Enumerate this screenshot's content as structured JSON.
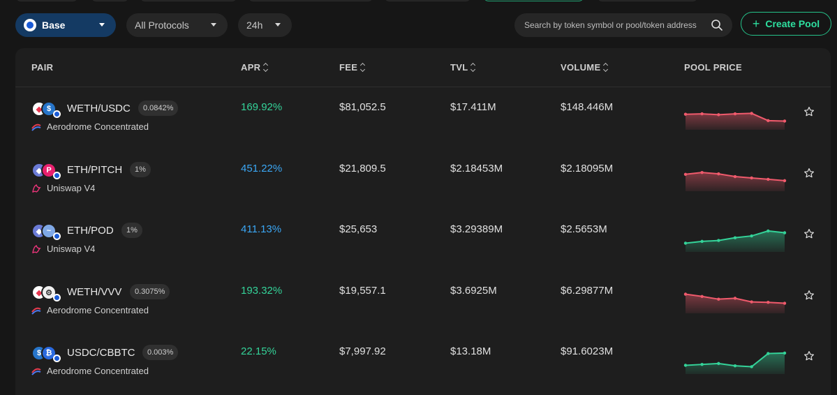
{
  "toolbar": {
    "chain_label": "Base",
    "protocol_filter": "All Protocols",
    "period": "24h",
    "search_placeholder": "Search by token symbol or pool/token address",
    "create_label": "Create Pool"
  },
  "columns": {
    "pair": "PAIR",
    "apr": "APR",
    "fee": "FEE",
    "tvl": "TVL",
    "volume": "VOLUME",
    "pool_price": "POOL PRICE"
  },
  "colors": {
    "positive": "#34d399",
    "negative": "#f05a6c",
    "apr_blue": "#3ba7f5",
    "accent": "#25c28a"
  },
  "rows": [
    {
      "pair": "WETH/USDC",
      "fee_tier": "0.0842%",
      "protocol": "Aerodrome Concentrated",
      "protocol_icon": "aerodrome-icon",
      "apr": "169.92%",
      "apr_color": "green",
      "fee": "$81,052.5",
      "tvl": "$17.411M",
      "volume": "$148.446M",
      "trend": "down",
      "price_series": [
        3,
        3.1,
        2.9,
        3.1,
        3.2,
        1.6,
        1.5
      ],
      "token_icons": [
        "weth-icon",
        "usdc-icon"
      ]
    },
    {
      "pair": "ETH/PITCH",
      "fee_tier": "1%",
      "protocol": "Uniswap V4",
      "protocol_icon": "uniswap-icon",
      "apr": "451.22%",
      "apr_color": "blue",
      "fee": "$21,809.5",
      "tvl": "$2.18453M",
      "volume": "$2.18095M",
      "trend": "down",
      "price_series": [
        3.3,
        3.7,
        3.4,
        2.8,
        2.5,
        2.2,
        1.9
      ],
      "token_icons": [
        "eth-icon",
        "pitch-icon"
      ]
    },
    {
      "pair": "ETH/POD",
      "fee_tier": "1%",
      "protocol": "Uniswap V4",
      "protocol_icon": "uniswap-icon",
      "apr": "411.13%",
      "apr_color": "blue",
      "fee": "$25,653",
      "tvl": "$3.29389M",
      "volume": "$2.5653M",
      "trend": "up",
      "price_series": [
        1.5,
        1.9,
        2.1,
        2.7,
        3.1,
        4.2,
        3.8
      ],
      "token_icons": [
        "eth-icon",
        "pod-icon"
      ]
    },
    {
      "pair": "WETH/VVV",
      "fee_tier": "0.3075%",
      "protocol": "Aerodrome Concentrated",
      "protocol_icon": "aerodrome-icon",
      "apr": "193.32%",
      "apr_color": "green",
      "fee": "$19,557.1",
      "tvl": "$3.6925M",
      "volume": "$6.29877M",
      "trend": "down",
      "price_series": [
        3.8,
        3.3,
        2.7,
        2.9,
        2.1,
        2.0,
        1.8
      ],
      "token_icons": [
        "weth-icon",
        "vvv-icon"
      ]
    },
    {
      "pair": "USDC/CBBTC",
      "fee_tier": "0.003%",
      "protocol": "Aerodrome Concentrated",
      "protocol_icon": "aerodrome-icon",
      "apr": "22.15%",
      "apr_color": "green",
      "fee": "$7,997.92",
      "tvl": "$13.18M",
      "volume": "$91.6023M",
      "trend": "up",
      "price_series": [
        1.5,
        1.7,
        1.9,
        1.4,
        1.2,
        4.1,
        4.2
      ],
      "token_icons": [
        "usdc-icon",
        "cbbtc-icon"
      ]
    }
  ]
}
